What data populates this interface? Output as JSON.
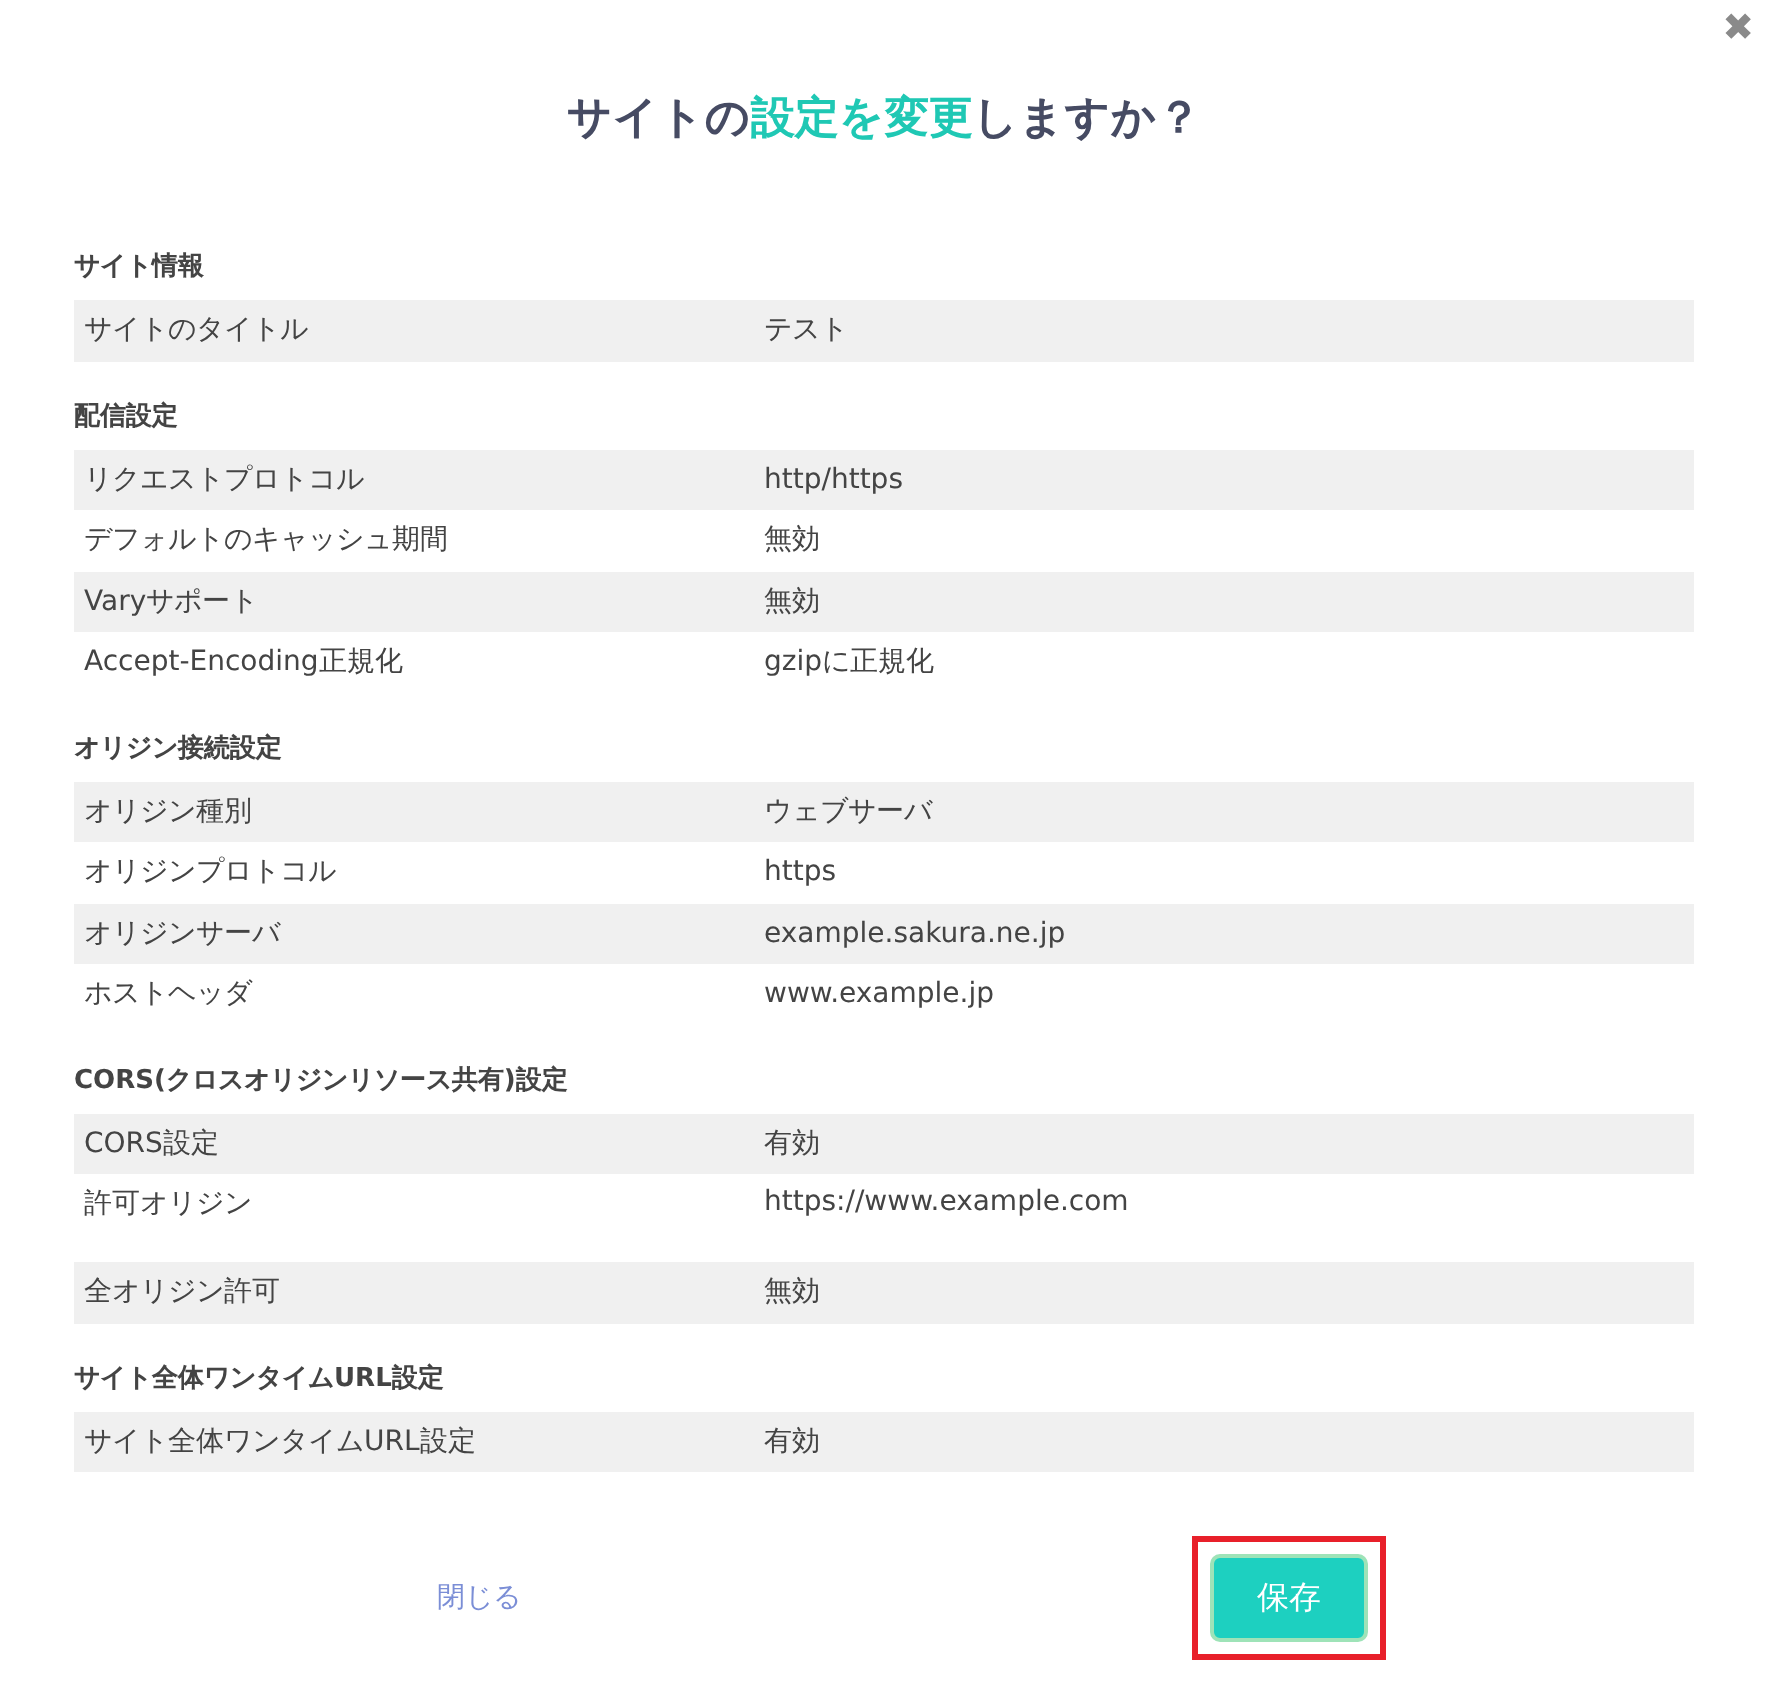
{
  "dialog": {
    "close_icon": "✖",
    "title": [
      {
        "text": "サイトの",
        "accent": false
      },
      {
        "text": "設定を変更",
        "accent": true
      },
      {
        "text": "しますか？",
        "accent": false
      }
    ]
  },
  "sections": [
    {
      "heading": "サイト情報",
      "rows": [
        {
          "label": "サイトのタイトル",
          "value": "テスト",
          "kind": "single"
        }
      ]
    },
    {
      "heading": "配信設定",
      "rows": [
        {
          "label": "リクエストプロトコル",
          "value": "http/https",
          "kind": "single"
        },
        {
          "label": "デフォルトのキャッシュ期間",
          "value": "無効",
          "kind": "single"
        },
        {
          "label": "Varyサポート",
          "value": "無効",
          "kind": "single"
        },
        {
          "label": "Accept-Encoding正規化",
          "value": "gzipに正規化",
          "kind": "single"
        }
      ]
    },
    {
      "heading": "オリジン接続設定",
      "rows": [
        {
          "label": "オリジン種別",
          "value": "ウェブサーバ",
          "kind": "single"
        },
        {
          "label": "オリジンプロトコル",
          "value": "https",
          "kind": "single"
        },
        {
          "label": "オリジンサーバ",
          "value": "example.sakura.ne.jp",
          "kind": "single"
        },
        {
          "label": "ホストヘッダ",
          "value": "www.example.jp",
          "kind": "single"
        }
      ]
    },
    {
      "heading": "CORS(クロスオリジンリソース共有)設定",
      "rows": [
        {
          "label": "CORS設定",
          "value": "有効",
          "kind": "single"
        },
        {
          "label": "許可オリジン",
          "value": "https://www.example.com",
          "kind": "multiline"
        },
        {
          "label": "全オリジン許可",
          "value": "無効",
          "kind": "single"
        }
      ]
    },
    {
      "heading": "サイト全体ワンタイムURL設定",
      "rows": [
        {
          "label": "サイト全体ワンタイムURL設定",
          "value": "有効",
          "kind": "single"
        }
      ]
    }
  ],
  "footer": {
    "close_link": "閉じる",
    "save_button": {
      "label": "保存",
      "highlighted": true
    }
  }
}
